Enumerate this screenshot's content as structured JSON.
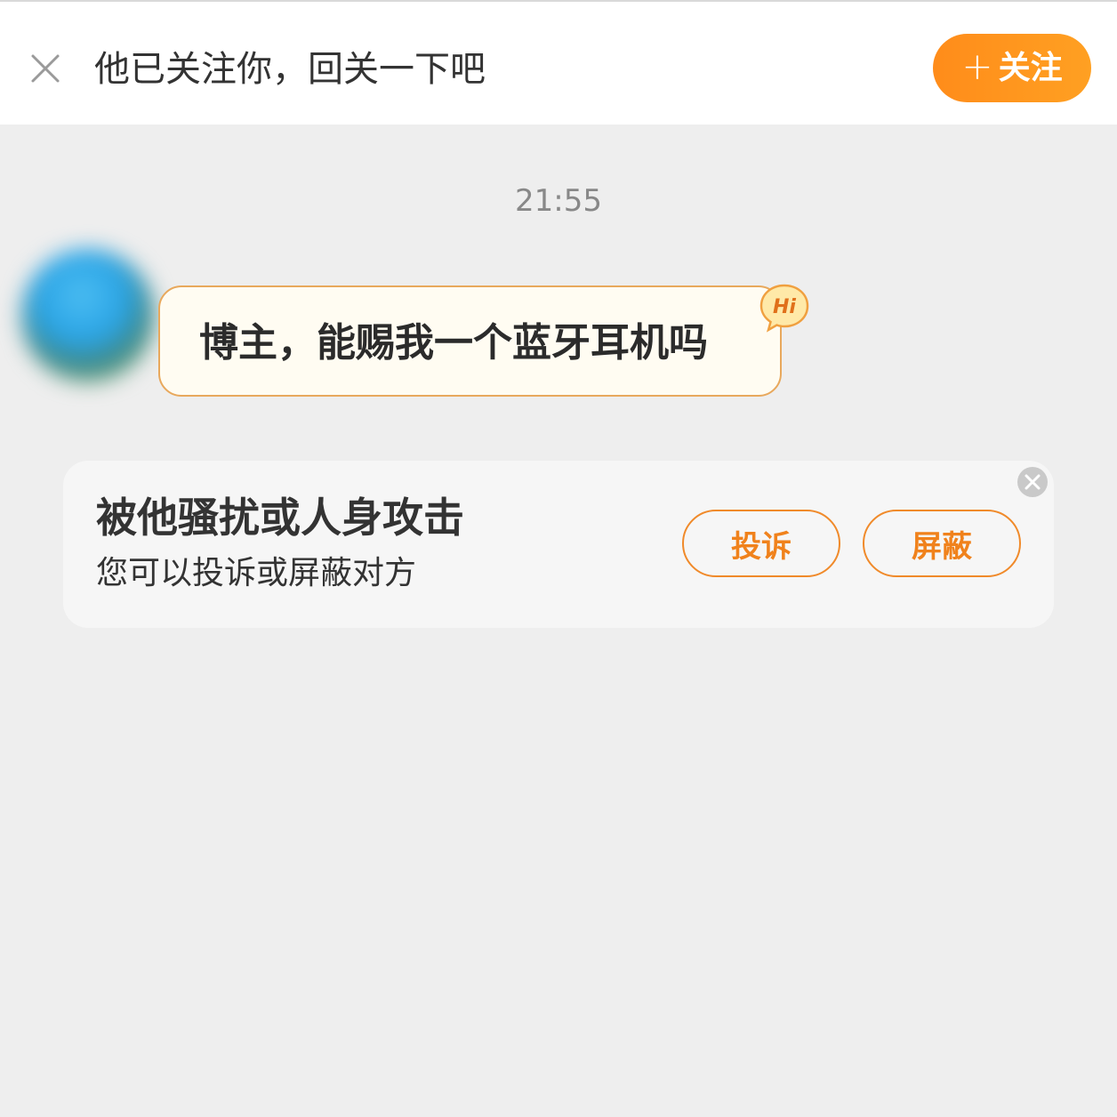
{
  "banner": {
    "close_icon": "close-icon",
    "text": "他已关注你，回关一下吧",
    "follow_button": {
      "plus": "+",
      "label": "关注",
      "color": "#ff9419"
    }
  },
  "chat": {
    "timestamp": "21:55",
    "messages": [
      {
        "sender": "other",
        "avatar": "avatar (blurred)",
        "text": "博主，能赐我一个蓝牙耳机吗",
        "badge": "Hi"
      }
    ]
  },
  "safety_card": {
    "title": "被他骚扰或人身攻击",
    "subtitle": "您可以投诉或屏蔽对方",
    "report_button": "投诉",
    "block_button": "屏蔽",
    "close_icon": "close-circle-icon",
    "accent_color": "#f0821c"
  }
}
